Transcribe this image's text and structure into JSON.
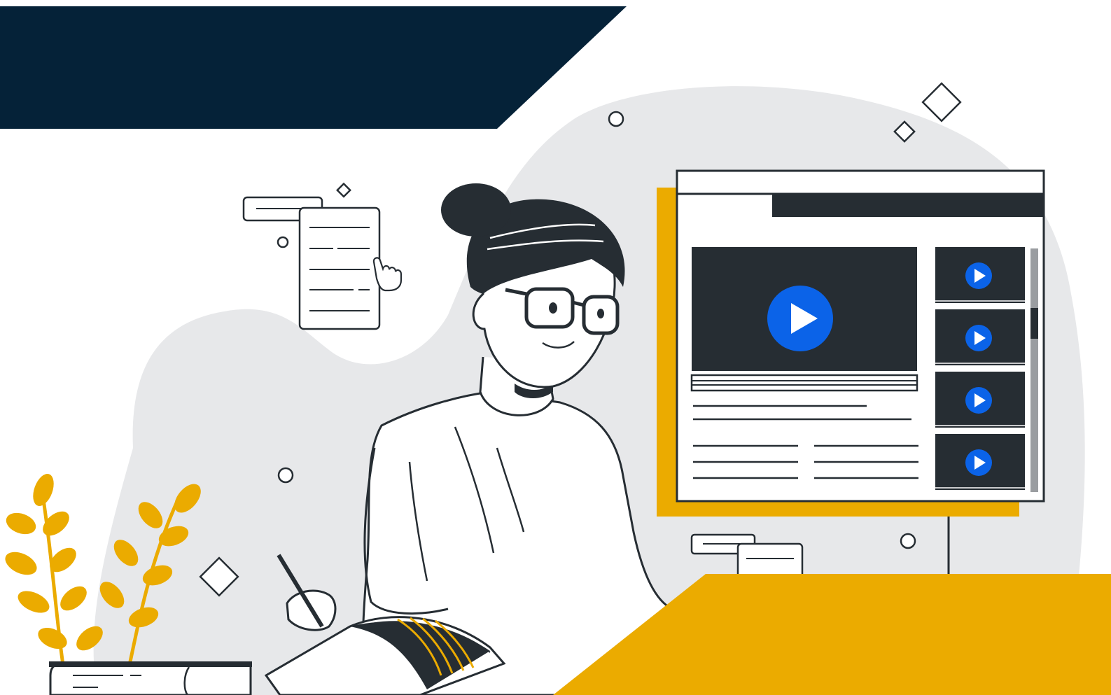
{
  "colors": {
    "navy": "#052238",
    "gold": "#EBAB00",
    "dark": "#262D33",
    "blob": "#E7E8EA",
    "play_blue": "#0B63E8",
    "white": "#FFFFFF"
  },
  "icons": {
    "main_play": "play-button-icon",
    "thumbnail_play": "play-button-icon",
    "pointer": "pointing-hand-icon",
    "diamond": "diamond-outline-icon",
    "circle": "circle-outline-icon"
  },
  "video_player": {
    "thumbnail_count": 4
  }
}
